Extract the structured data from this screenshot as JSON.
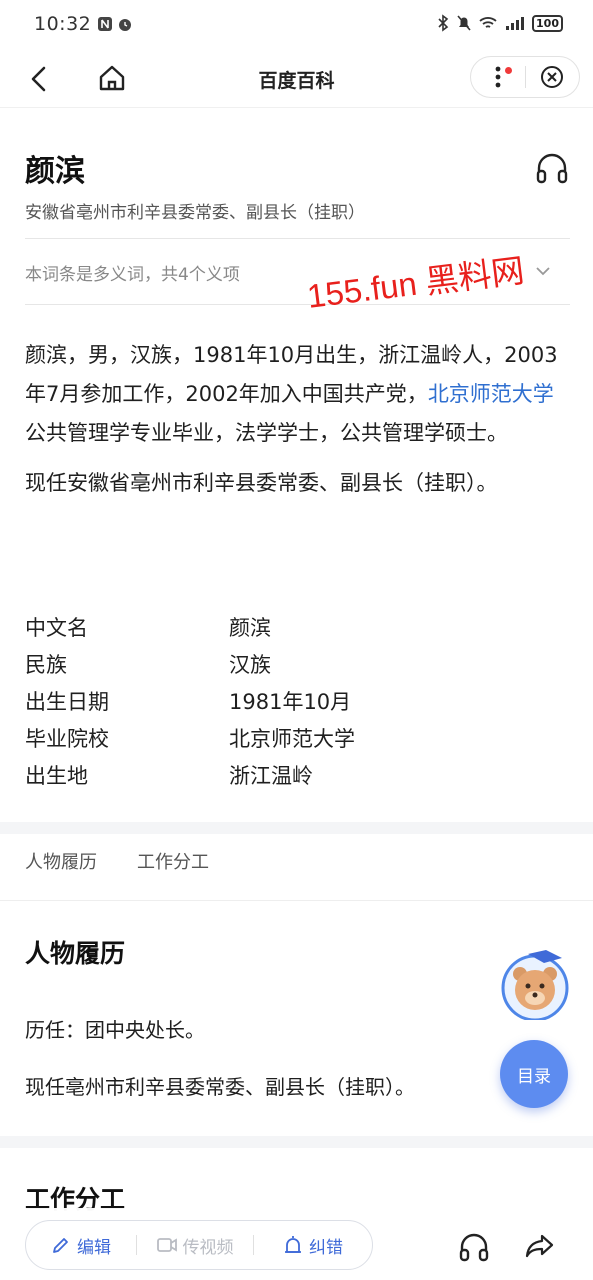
{
  "status": {
    "time": "10:32",
    "battery": "100"
  },
  "nav": {
    "title": "百度百科"
  },
  "entry": {
    "title": "颜滨",
    "subtitle": "安徽省亳州市利辛县委常委、副县长（挂职）",
    "polysemy": "本词条是多义词，共4个义项"
  },
  "watermark": "155.fun 黑料网",
  "summary": {
    "p1_before_link": "颜滨，男，汉族，1981年10月出生，浙江温岭人，2003年7月参加工作，2002年加入中国共产党，",
    "p1_link": "北京师范大学",
    "p1_after_link": "公共管理学专业毕业，法学学士，公共管理学硕士。",
    "p2": "现任安徽省亳州市利辛县委常委、副县长（挂职）。"
  },
  "infobox": [
    {
      "key": "中文名",
      "value": "颜滨"
    },
    {
      "key": "民族",
      "value": "汉族"
    },
    {
      "key": "出生日期",
      "value": "1981年10月"
    },
    {
      "key": "毕业院校",
      "value": "北京师范大学"
    },
    {
      "key": "出生地",
      "value": "浙江温岭"
    }
  ],
  "tabs": [
    "人物履历",
    "工作分工"
  ],
  "sections": {
    "resume_heading": "人物履历",
    "resume_line1": "历任：团中央处长。",
    "resume_line2": "现任亳州市利辛县委常委、副县长（挂职）。",
    "work_heading": "工作分工"
  },
  "toc_label": "目录",
  "bottom": {
    "edit": "编辑",
    "video": "传视频",
    "correct": "纠错"
  },
  "colors": {
    "link": "#2f6fd0",
    "accent": "#3f6ad8",
    "toc_bg": "#5d8cf0",
    "watermark": "#e8201c"
  }
}
